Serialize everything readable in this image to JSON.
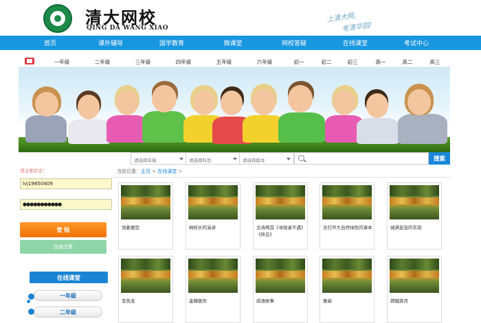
{
  "header": {
    "title": "清大网校",
    "subtitle": "QING DA WANG XIAO",
    "slogan_line1": "上清大网,",
    "slogan_line2": "考清华园!"
  },
  "nav": [
    "首页",
    "课外辅导",
    "国学教育",
    "微课堂",
    "网校答疑",
    "在线课堂",
    "考试中心"
  ],
  "grades": [
    "一年级",
    "二年级",
    "三年级",
    "四年级",
    "五年级",
    "六年级",
    "初一",
    "初二",
    "初三",
    "高一",
    "高二",
    "高三"
  ],
  "search": {
    "grade_placeholder": "请选择年级",
    "subject_placeholder": "请选择科目",
    "version_placeholder": "请选择版本",
    "button": "搜索"
  },
  "login": {
    "warning": "请注意验证！",
    "username": "lvj19850409",
    "password": "●●●●●●●●●●●",
    "login_button": "登 陆",
    "register_button": "在线注册"
  },
  "sidebar": {
    "tab_label": "在线课堂",
    "grades": [
      "一年级",
      "二年级"
    ]
  },
  "breadcrumb": {
    "prefix": "当前位置：",
    "home": "主页",
    "separator": " > ",
    "current": "在线课堂",
    "end": " >"
  },
  "courses": [
    {
      "title": "饱萎雅您"
    },
    {
      "title": "拇校长的演讲"
    },
    {
      "title": "古诗两首《寻隐者不遇》《所见》"
    },
    {
      "title": "去打开大自然绿色的课本"
    },
    {
      "title": "绒满昆虫的衣袋"
    },
    {
      "title": "变色龙"
    },
    {
      "title": "金蝉脱壳"
    },
    {
      "title": "成语故事"
    },
    {
      "title": "推敲"
    },
    {
      "title": "嫦娥奔月"
    }
  ],
  "colors": {
    "nav_blue": "#1896e0",
    "search_blue": "#1a87d8",
    "login_orange": "#f07100",
    "register_green": "#8fd5a8"
  }
}
